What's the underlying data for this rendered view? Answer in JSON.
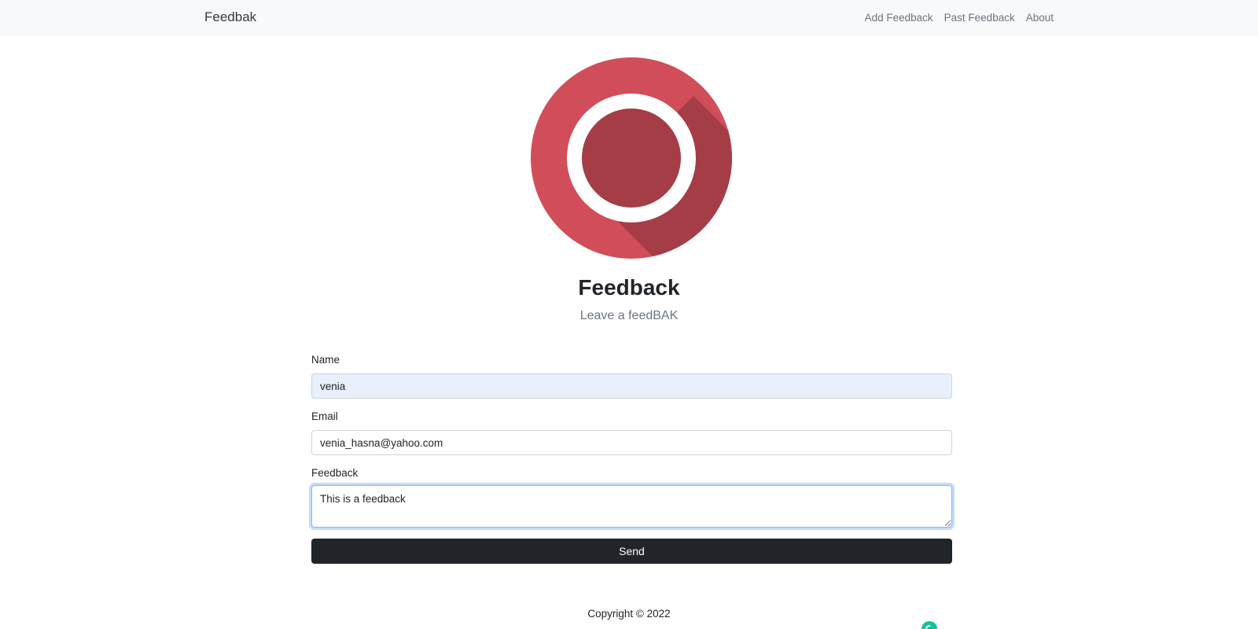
{
  "navbar": {
    "brand": "Feedbak",
    "links": [
      "Add Feedback",
      "Past Feedback",
      "About"
    ]
  },
  "logo": {
    "icon": "target-circle-logo",
    "colors": {
      "outer": "#d14d59",
      "shadow": "#a53d47",
      "ring": "#ffffff",
      "inner": "#a53d47"
    }
  },
  "hero": {
    "title": "Feedback",
    "subtitle": "Leave a feedBAK"
  },
  "form": {
    "name": {
      "label": "Name",
      "value": "venia"
    },
    "email": {
      "label": "Email",
      "value": "venia_hasna@yahoo.com"
    },
    "feedback": {
      "label": "Feedback",
      "value": "This is a feedback"
    },
    "submit_label": "Send"
  },
  "footer": {
    "copyright": "Copyright © 2022"
  }
}
